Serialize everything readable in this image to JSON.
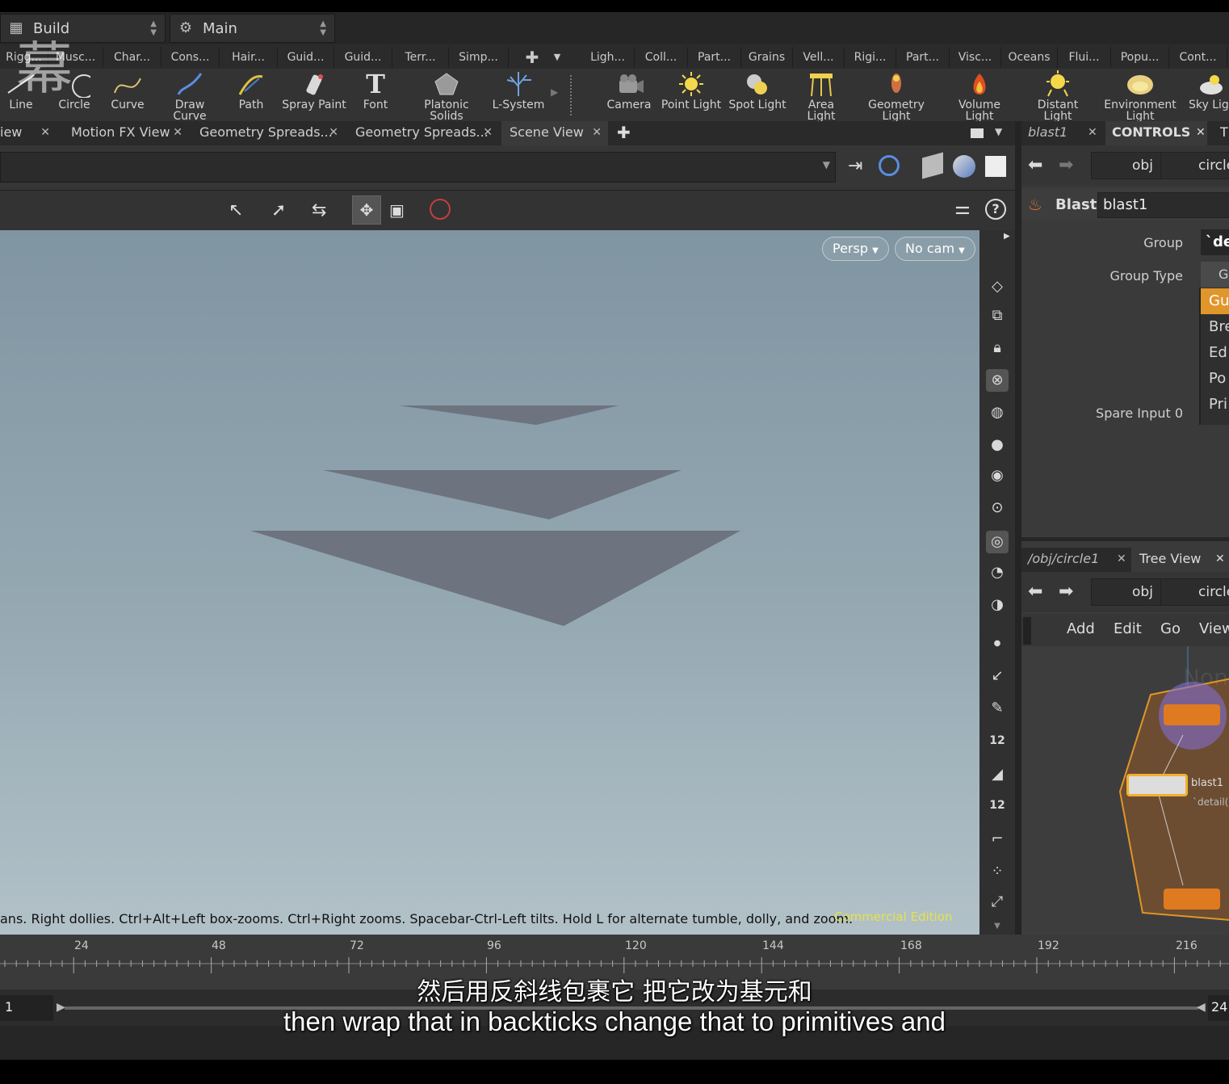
{
  "topbar": {
    "desktop_label": "Build",
    "network_label": "Main"
  },
  "shelf_tabs_left": [
    "Rigg...",
    "Musc...",
    "Char...",
    "Cons...",
    "Hair...",
    "Guid...",
    "Guid...",
    "Terr...",
    "Simp..."
  ],
  "shelf_tabs_right": [
    "Ligh...",
    "Coll...",
    "Part...",
    "Grains",
    "Vell...",
    "Rigi...",
    "Part...",
    "Visc...",
    "Oceans",
    "Flui...",
    "Popu...",
    "Cont..."
  ],
  "shelf_tools_left": [
    {
      "label": "Line",
      "icon": "line-icon"
    },
    {
      "label": "Circle",
      "icon": "circle-icon"
    },
    {
      "label": "Curve",
      "icon": "curve-icon"
    },
    {
      "label": "Draw Curve",
      "icon": "draw-curve-icon"
    },
    {
      "label": "Path",
      "icon": "path-icon"
    },
    {
      "label": "Spray Paint",
      "icon": "spray-paint-icon"
    },
    {
      "label": "Font",
      "icon": "font-icon"
    },
    {
      "label": "Platonic Solids",
      "icon": "platonic-solids-icon"
    },
    {
      "label": "L-System",
      "icon": "l-system-icon"
    }
  ],
  "shelf_tools_right": [
    {
      "label": "Camera",
      "icon": "camera-icon"
    },
    {
      "label": "Point Light",
      "icon": "point-light-icon"
    },
    {
      "label": "Spot Light",
      "icon": "spot-light-icon"
    },
    {
      "label": "Area Light",
      "icon": "area-light-icon"
    },
    {
      "label": "Geometry Light",
      "icon": "geometry-light-icon"
    },
    {
      "label": "Volume Light",
      "icon": "volume-light-icon"
    },
    {
      "label": "Distant Light",
      "icon": "distant-light-icon"
    },
    {
      "label": "Environment Light",
      "icon": "environment-light-icon"
    },
    {
      "label": "Sky Ligh",
      "icon": "sky-light-icon"
    }
  ],
  "pane_tabs": [
    "iew",
    "Motion FX View",
    "Geometry Spreads...",
    "Geometry Spreads...",
    "Scene View"
  ],
  "viewport": {
    "persp_label": "Persp",
    "cam_label": "No cam",
    "status_text": "ans. Right dollies. Ctrl+Alt+Left box-zooms. Ctrl+Right zooms. Spacebar-Ctrl-Left tilts. Hold L for alternate tumble, dolly, and zoom.",
    "edition_text": "Commercial Edition",
    "geometry_color": "#6d737f",
    "snap_labels": [
      "12",
      "12"
    ]
  },
  "param_pane": {
    "tabs": [
      "blast1",
      "CONTROLS",
      "T"
    ],
    "breadcrumb": [
      "obj",
      "circle"
    ],
    "node_type": "Blast",
    "node_name": "blast1",
    "params": [
      {
        "label": "Group",
        "value": "`de"
      },
      {
        "label": "Group Type",
        "value": "G"
      },
      {
        "label": "Spare Input 0",
        "value": ""
      }
    ],
    "menu_items": [
      "Gu",
      "Bre",
      "Ed",
      "Po",
      "Pri"
    ],
    "menu_selected": "Gu",
    "accent_color": "#e0962a"
  },
  "network_pane": {
    "tabs": [
      "/obj/circle1",
      "Tree View"
    ],
    "breadcrumb": [
      "obj",
      "circle"
    ],
    "menu": [
      "Add",
      "Edit",
      "Go",
      "View"
    ],
    "node_label": "blast1",
    "node_sublabel": "`detail(",
    "watermark": "Non"
  },
  "timeline": {
    "ticks": [
      "24",
      "48",
      "72",
      "96",
      "120",
      "144",
      "168",
      "192",
      "216"
    ],
    "current_frame": "1",
    "end_frame": "24"
  },
  "subtitles": {
    "zh": "然后用反斜线包裹它 把它改为基元和",
    "en": "then wrap that in backticks change that to primitives and"
  },
  "watermark_glyph": "幕"
}
